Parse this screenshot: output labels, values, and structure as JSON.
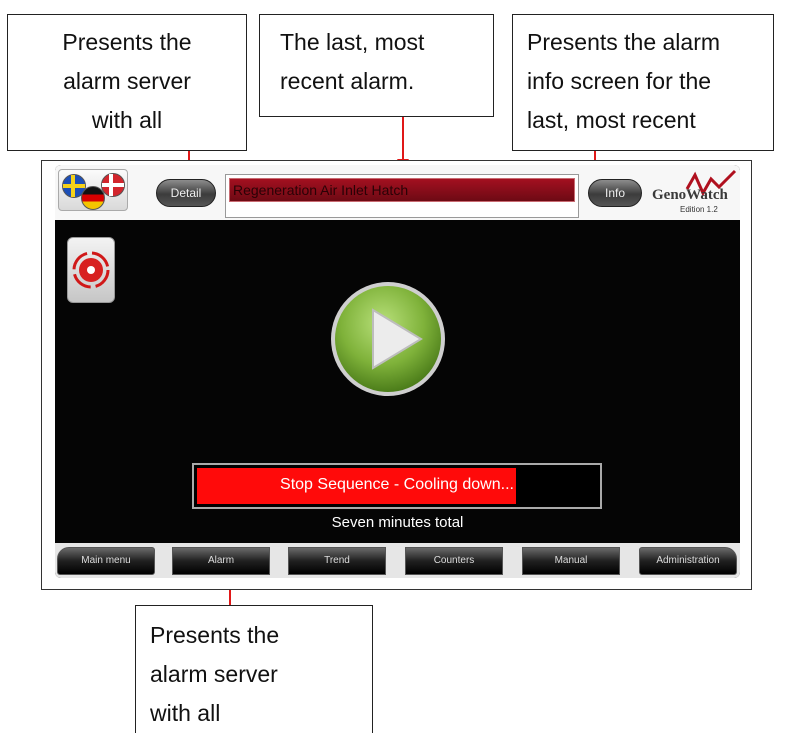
{
  "callouts": {
    "detail": [
      "Presents the",
      "alarm server",
      "with all"
    ],
    "last_alarm": [
      "The last, most",
      "recent alarm."
    ],
    "info": [
      "Presents the alarm",
      "info screen for the",
      "last, most recent"
    ],
    "alarm_nav": [
      "Presents the",
      "alarm server",
      "with all"
    ]
  },
  "header": {
    "detail_label": "Detail",
    "info_label": "Info",
    "last_alarm": "Regeneration Air Inlet Hatch",
    "logo_text": "GenoWatch",
    "edition": "Edition 1.2",
    "languages": [
      "Swedish",
      "German",
      "Danish"
    ]
  },
  "main": {
    "emergency_icon": "emergency-stop-icon",
    "play_icon": "play-icon",
    "status_text": "Stop Sequence - Cooling down...",
    "status_progress": 0.8,
    "subtext": "Seven minutes total"
  },
  "nav": {
    "items": [
      "Main menu",
      "Alarm",
      "Trend",
      "Counters",
      "Manual",
      "Administration"
    ]
  },
  "colors": {
    "alarm_bar": "#8b0f1c",
    "status_fill": "#ff0a0a",
    "play_green": "#7fb23a",
    "arrow": "#e01818"
  }
}
